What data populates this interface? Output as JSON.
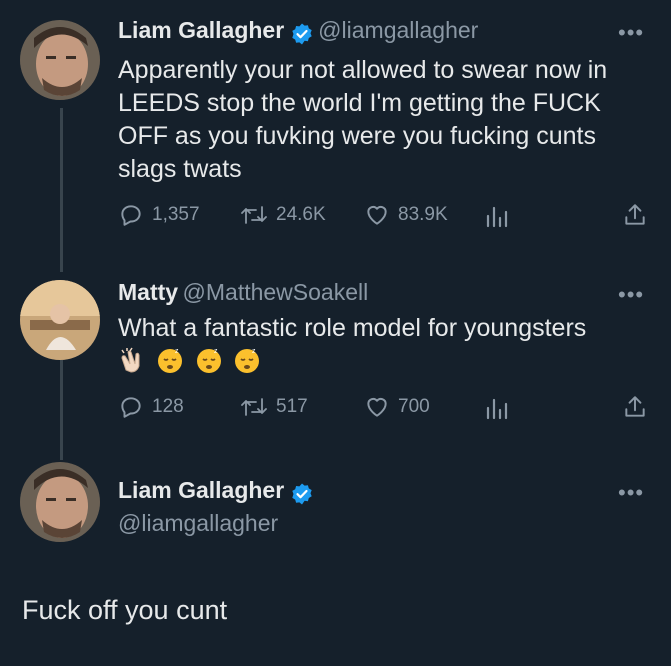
{
  "tweets": [
    {
      "name": "Liam Gallagher",
      "handle": "@liamgallagher",
      "text": "Apparently your not allowed to swear now in LEEDS stop the world I'm getting the FUCK OFF as you fuvking were you fucking cunts slags twats",
      "replies": "1,357",
      "retweets": "24.6K",
      "likes": "83.9K",
      "verified": true
    },
    {
      "name": "Matty",
      "handle": "@MatthewSoakell",
      "text": "What a fantastic role model for youngsters",
      "emojis": [
        "clapping-hands",
        "sleeping-face",
        "sleeping-face",
        "sleeping-face"
      ],
      "replies": "128",
      "retweets": "517",
      "likes": "700",
      "verified": false
    },
    {
      "name": "Liam Gallagher",
      "handle": "@liamgallagher",
      "text": "Fuck off you cunt",
      "verified": true
    }
  ],
  "more_label": "•••",
  "colors": {
    "background": "#15202b",
    "text": "#e7e9ea",
    "secondary": "#8b98a5",
    "verified": "#1d9bf0",
    "thread_line": "#38444d"
  }
}
